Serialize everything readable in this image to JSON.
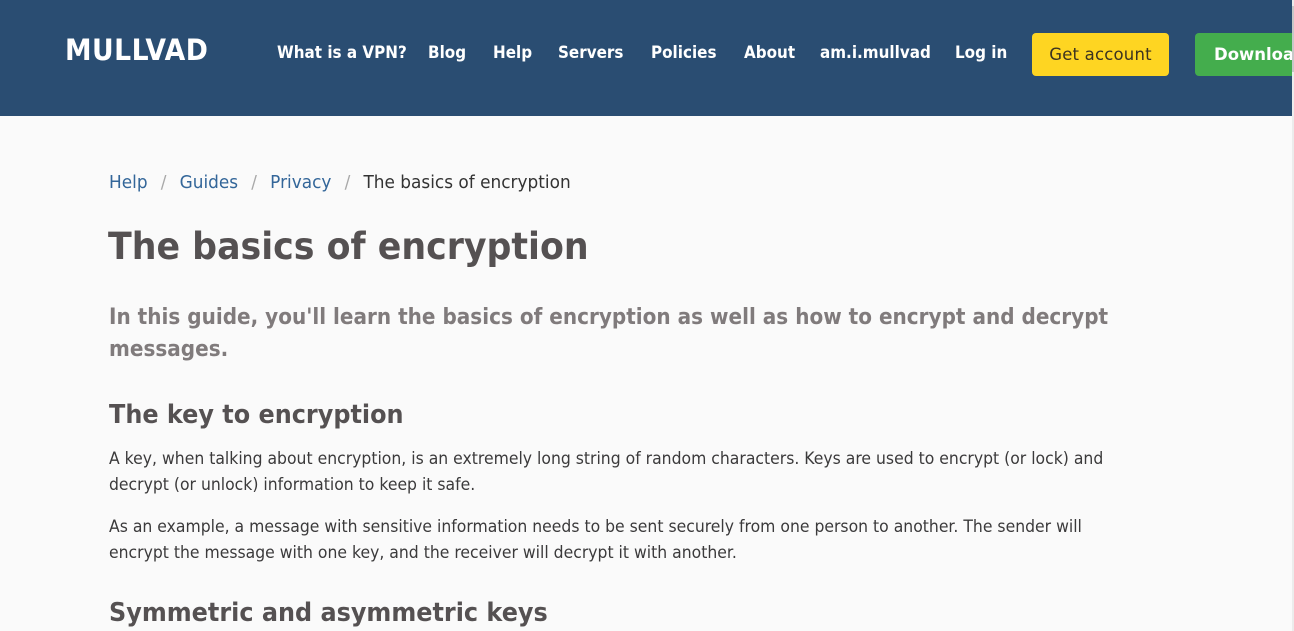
{
  "header": {
    "logo": "MULLVAD",
    "nav": [
      {
        "label": "What is a VPN?"
      },
      {
        "label": "Blog"
      },
      {
        "label": "Help"
      },
      {
        "label": "Servers"
      },
      {
        "label": "Policies"
      },
      {
        "label": "About"
      },
      {
        "label": "am.i.mullvad"
      },
      {
        "label": "Log in"
      }
    ],
    "get_account_label": "Get account",
    "download_label": "Download"
  },
  "breadcrumb": {
    "items": [
      {
        "label": "Help"
      },
      {
        "label": "Guides"
      },
      {
        "label": "Privacy"
      }
    ],
    "separator": "/",
    "current": "The basics of encryption"
  },
  "article": {
    "title": "The basics of encryption",
    "lead": "In this guide, you'll learn the basics of encryption as well as how to encrypt and decrypt messages.",
    "sections": [
      {
        "heading": "The key to encryption",
        "paragraphs": [
          "A key, when talking about encryption, is an extremely long string of random characters. Keys are used to encrypt (or lock) and decrypt (or unlock) information to keep it safe.",
          "As an example, a message with sensitive information needs to be sent securely from one person to another. The sender will encrypt the message with one key, and the receiver will decrypt it with another."
        ]
      },
      {
        "heading": "Symmetric and asymmetric keys"
      }
    ]
  },
  "colors": {
    "header_bg": "#2a4d72",
    "get_account_bg": "#fed522",
    "download_bg": "#44ad4d",
    "link": "#336699",
    "heading": "#555152",
    "lead": "#807b7c",
    "body_text": "#3b3a3b",
    "page_bg": "#fafafa"
  }
}
